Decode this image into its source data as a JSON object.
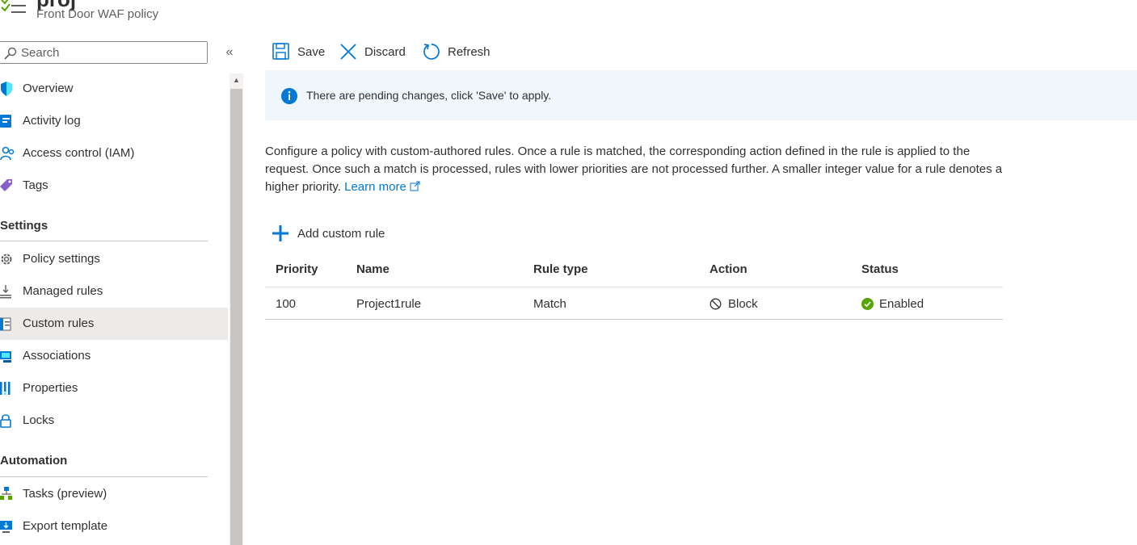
{
  "header": {
    "title_fragment": "proj",
    "subtitle": "Front Door WAF policy"
  },
  "sidebar": {
    "search_placeholder": "Search",
    "collapse_glyph": "«",
    "items_top": [
      {
        "label": "Overview",
        "icon": "overview-shield-icon"
      },
      {
        "label": "Activity log",
        "icon": "activity-log-icon"
      },
      {
        "label": "Access control (IAM)",
        "icon": "iam-people-icon"
      },
      {
        "label": "Tags",
        "icon": "tag-icon"
      }
    ],
    "settings": {
      "header": "Settings",
      "items": [
        {
          "label": "Policy settings",
          "icon": "gear-icon"
        },
        {
          "label": "Managed rules",
          "icon": "managed-rules-icon"
        },
        {
          "label": "Custom rules",
          "icon": "custom-rules-icon",
          "selected": true
        },
        {
          "label": "Associations",
          "icon": "associations-icon"
        },
        {
          "label": "Properties",
          "icon": "properties-bars-icon"
        },
        {
          "label": "Locks",
          "icon": "lock-icon"
        }
      ]
    },
    "automation": {
      "header": "Automation",
      "items": [
        {
          "label": "Tasks (preview)",
          "icon": "tasks-icon"
        },
        {
          "label": "Export template",
          "icon": "export-template-icon"
        }
      ]
    }
  },
  "toolbar": {
    "save_label": "Save",
    "discard_label": "Discard",
    "refresh_label": "Refresh"
  },
  "banner": {
    "message": "There are pending changes, click 'Save' to apply."
  },
  "description": {
    "text": "Configure a policy with custom-authored rules. Once a rule is matched, the corresponding action defined in the rule is applied to the request. Once such a match is processed, rules with lower priorities are not processed further. A smaller integer value for a rule denotes a higher priority.",
    "link_label": "Learn more"
  },
  "add_rule_label": "Add custom rule",
  "table": {
    "columns": [
      "Priority",
      "Name",
      "Rule type",
      "Action",
      "Status"
    ],
    "rows": [
      {
        "priority": "100",
        "name": "Project1rule",
        "rule_type": "Match",
        "action": "Block",
        "status": "Enabled"
      }
    ]
  },
  "colors": {
    "accent": "#0078d4",
    "success": "#57a300",
    "banner_bg": "#eff6fc",
    "selected_bg": "#edebe9"
  }
}
